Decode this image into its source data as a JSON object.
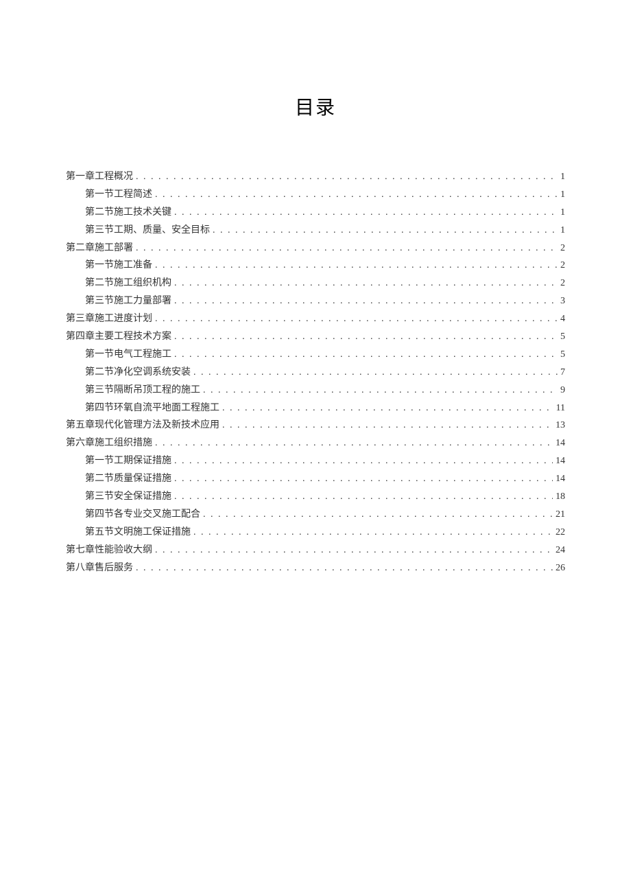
{
  "title": "目录",
  "toc": [
    {
      "label": "第一章工程概况",
      "page": "1",
      "indent": false
    },
    {
      "label": "第一节工程简述",
      "page": "1",
      "indent": true
    },
    {
      "label": "第二节施工技术关键",
      "page": "1",
      "indent": true
    },
    {
      "label": "第三节工期、质量、安全目标",
      "page": "1",
      "indent": true
    },
    {
      "label": "第二章施工部署",
      "page": "2",
      "indent": false
    },
    {
      "label": "第一节施工准备",
      "page": "2",
      "indent": true
    },
    {
      "label": "第二节施工组织机构",
      "page": "2",
      "indent": true
    },
    {
      "label": "第三节施工力量部署",
      "page": "3",
      "indent": true
    },
    {
      "label": "第三章施工进度计划",
      "page": "4",
      "indent": false
    },
    {
      "label": "第四章主要工程技术方案",
      "page": "5",
      "indent": false
    },
    {
      "label": "第一节电气工程施工",
      "page": "5",
      "indent": true
    },
    {
      "label": "第二节净化空调系统安装",
      "page": "7",
      "indent": true
    },
    {
      "label": "第三节隔断吊顶工程的施工",
      "page": "9",
      "indent": true
    },
    {
      "label": "第四节环氧自流平地面工程施工",
      "page": "11",
      "indent": true
    },
    {
      "label": "第五章现代化管理方法及新技术应用",
      "page": "13",
      "indent": false
    },
    {
      "label": "第六章施工组织措施",
      "page": "14",
      "indent": false
    },
    {
      "label": "第一节工期保证措施",
      "page": "14",
      "indent": true
    },
    {
      "label": "第二节质量保证措施",
      "page": "14",
      "indent": true
    },
    {
      "label": "第三节安全保证措施",
      "page": "18",
      "indent": true
    },
    {
      "label": "第四节各专业交叉施工配合",
      "page": "21",
      "indent": true
    },
    {
      "label": "第五节文明施工保证措施",
      "page": "22",
      "indent": true
    },
    {
      "label": "第七章性能验收大纲",
      "page": "24",
      "indent": false
    },
    {
      "label": "第八章售后服务",
      "page": "26",
      "indent": false
    }
  ]
}
